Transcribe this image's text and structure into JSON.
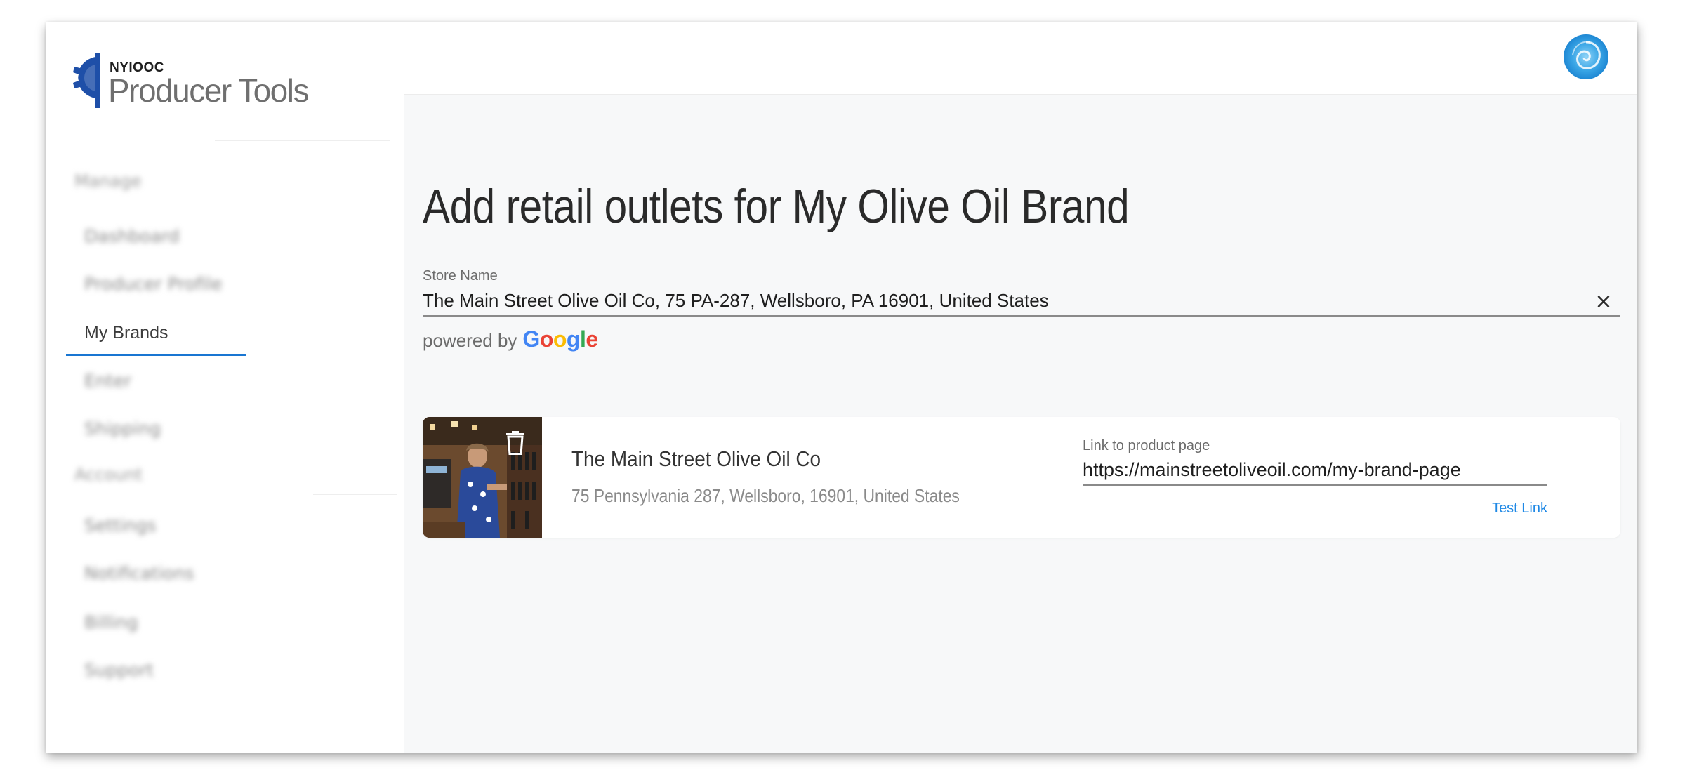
{
  "app": {
    "logo_small": "NYIOOC",
    "logo_big": "Producer Tools"
  },
  "sidebar": {
    "sections": [
      "Manage",
      "Account"
    ],
    "items": [
      {
        "label": "Dashboard",
        "active": false
      },
      {
        "label": "Producer Profile",
        "active": false
      },
      {
        "label": "My Brands",
        "active": true
      },
      {
        "label": "Enter",
        "active": false
      },
      {
        "label": "Shipping",
        "active": false
      },
      {
        "label": "Settings",
        "active": false
      },
      {
        "label": "Notifications",
        "active": false
      },
      {
        "label": "Billing",
        "active": false
      },
      {
        "label": "Support",
        "active": false
      }
    ]
  },
  "page": {
    "title": "Add retail outlets for My Olive Oil Brand"
  },
  "store_search": {
    "label": "Store Name",
    "value": "The Main Street Olive Oil Co, 75 PA-287, Wellsboro, PA 16901, United States",
    "clear_symbol": "×",
    "powered_by": "powered by",
    "google_letters": [
      "G",
      "o",
      "o",
      "g",
      "l",
      "e"
    ]
  },
  "outlet": {
    "name": "The Main Street Olive Oil Co",
    "address": "75 Pennsylvania 287, Wellsboro, 16901, United States",
    "link_label": "Link to product page",
    "link_value": "https://mainstreetoliveoil.com/my-brand-page",
    "test_link": "Test Link"
  },
  "colors": {
    "accent": "#1976d2",
    "link": "#1e88e5",
    "google": [
      "#4285F4",
      "#EA4335",
      "#FBBC05",
      "#4285F4",
      "#34A853",
      "#EA4335"
    ]
  },
  "icons": {
    "logo": "gear-logo-icon",
    "avatar": "user-avatar",
    "clear": "close-icon",
    "delete": "trash-icon"
  }
}
